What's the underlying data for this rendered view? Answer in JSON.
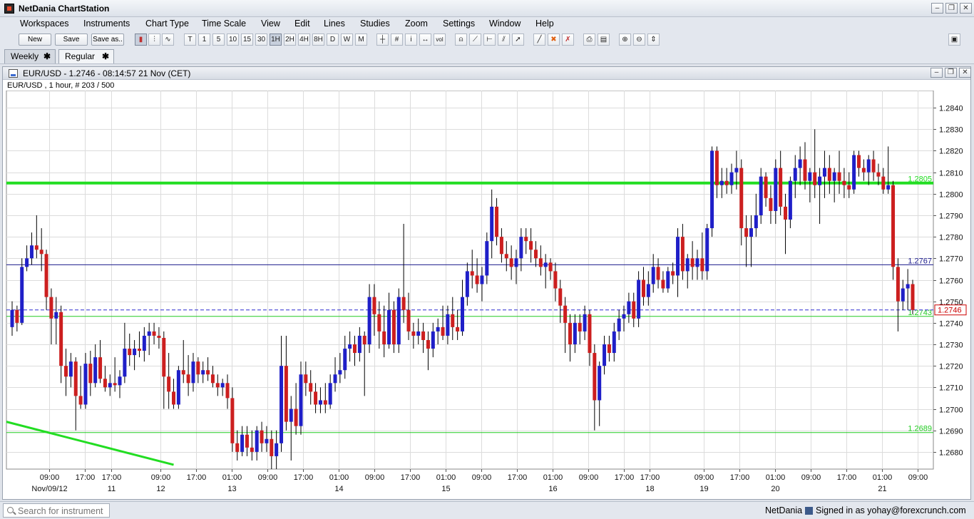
{
  "app": {
    "title": "NetDania ChartStation"
  },
  "menu": [
    "Workspaces",
    "Instruments",
    "Chart Type",
    "Time Scale",
    "View",
    "Edit",
    "Lines",
    "Studies",
    "Zoom",
    "Settings",
    "Window",
    "Help"
  ],
  "toolbar": {
    "new_label": "New",
    "save_label": "Save",
    "saveas_label": "Save as..",
    "interval_buttons": [
      "T",
      "1",
      "5",
      "10",
      "15",
      "30",
      "1H",
      "2H",
      "4H",
      "8H",
      "D",
      "W",
      "M"
    ],
    "active_interval": "1H",
    "vol_label": "vol"
  },
  "tabs": [
    {
      "label": "Weekly",
      "close": "✱"
    },
    {
      "label": "Regular",
      "close": "✱"
    }
  ],
  "chart": {
    "window_title": "EUR/USD - 1.2746 - 08:14:57  21 Nov (CET)",
    "subtitle": "EUR/USD , 1 hour, # 203 / 500"
  },
  "chart_data": {
    "type": "candlestick",
    "instrument": "EUR/USD",
    "interval": "1 hour",
    "last_price": 1.2746,
    "ylim": [
      1.2672,
      1.2848
    ],
    "y_ticks": [
      "1.2680",
      "1.2690",
      "1.2700",
      "1.2710",
      "1.2720",
      "1.2730",
      "1.2740",
      "1.2750",
      "1.2760",
      "1.2770",
      "1.2780",
      "1.2790",
      "1.2800",
      "1.2810",
      "1.2820",
      "1.2830",
      "1.2840"
    ],
    "x_ticks": [
      {
        "time": "09:00",
        "date": "Nov/09/12"
      },
      {
        "time": "17:00",
        "date": ""
      },
      {
        "time": "17:00",
        "date": "11"
      },
      {
        "time": "09:00",
        "date": "12"
      },
      {
        "time": "17:00",
        "date": ""
      },
      {
        "time": "01:00",
        "date": "13"
      },
      {
        "time": "09:00",
        "date": ""
      },
      {
        "time": "17:00",
        "date": ""
      },
      {
        "time": "01:00",
        "date": "14"
      },
      {
        "time": "09:00",
        "date": ""
      },
      {
        "time": "17:00",
        "date": ""
      },
      {
        "time": "01:00",
        "date": "15"
      },
      {
        "time": "09:00",
        "date": ""
      },
      {
        "time": "17:00",
        "date": ""
      },
      {
        "time": "01:00",
        "date": "16"
      },
      {
        "time": "09:00",
        "date": ""
      },
      {
        "time": "17:00",
        "date": ""
      },
      {
        "time": "17:00",
        "date": "18"
      },
      {
        "time": "09:00",
        "date": "19"
      },
      {
        "time": "17:00",
        "date": ""
      },
      {
        "time": "01:00",
        "date": "20"
      },
      {
        "time": "09:00",
        "date": ""
      },
      {
        "time": "17:00",
        "date": ""
      },
      {
        "time": "01:00",
        "date": "21"
      },
      {
        "time": "09:00",
        "date": ""
      }
    ],
    "horizontal_lines": [
      {
        "label": "1.2805",
        "value": 1.2805,
        "color": "#22dd22",
        "style": "thick"
      },
      {
        "label": "1.2767",
        "value": 1.2767,
        "color": "#1a1a8c",
        "style": "thin"
      },
      {
        "label": "1.2743",
        "value": 1.2743,
        "color": "#22cc22",
        "style": "thin"
      },
      {
        "label": "1.2689",
        "value": 1.2689,
        "color": "#22cc22",
        "style": "thin"
      }
    ],
    "price_marker": {
      "label": "1.2746",
      "value": 1.2746,
      "color": "#cc0000"
    },
    "colors": {
      "up": "#1f1fc8",
      "down": "#cc1f1f",
      "wick": "#000000"
    },
    "candles": [
      [
        1.2738,
        1.275,
        1.2734,
        1.2746
      ],
      [
        1.2746,
        1.2748,
        1.2736,
        1.274
      ],
      [
        1.274,
        1.277,
        1.2739,
        1.2766
      ],
      [
        1.2766,
        1.2776,
        1.2764,
        1.277
      ],
      [
        1.277,
        1.2782,
        1.2767,
        1.2776
      ],
      [
        1.2776,
        1.279,
        1.277,
        1.2774
      ],
      [
        1.2774,
        1.2784,
        1.2764,
        1.2772
      ],
      [
        1.2772,
        1.2774,
        1.2746,
        1.2752
      ],
      [
        1.2752,
        1.2756,
        1.273,
        1.2742
      ],
      [
        1.2742,
        1.2752,
        1.273,
        1.2745
      ],
      [
        1.2745,
        1.2748,
        1.2712,
        1.272
      ],
      [
        1.272,
        1.2728,
        1.2706,
        1.2715
      ],
      [
        1.2715,
        1.2726,
        1.271,
        1.2722
      ],
      [
        1.2722,
        1.2724,
        1.269,
        1.2706
      ],
      [
        1.2706,
        1.272,
        1.27,
        1.2702
      ],
      [
        1.2702,
        1.2726,
        1.27,
        1.2721
      ],
      [
        1.2721,
        1.2727,
        1.2706,
        1.2712
      ],
      [
        1.2712,
        1.273,
        1.271,
        1.2724
      ],
      [
        1.2724,
        1.2732,
        1.2712,
        1.2714
      ],
      [
        1.2714,
        1.272,
        1.2708,
        1.271
      ],
      [
        1.271,
        1.2716,
        1.2706,
        1.2712
      ],
      [
        1.2712,
        1.2724,
        1.2708,
        1.2711
      ],
      [
        1.2711,
        1.2718,
        1.2705,
        1.2715
      ],
      [
        1.2715,
        1.274,
        1.2712,
        1.2728
      ],
      [
        1.2728,
        1.2735,
        1.272,
        1.2725
      ],
      [
        1.2725,
        1.2732,
        1.2718,
        1.2728
      ],
      [
        1.2728,
        1.2736,
        1.2724,
        1.2727
      ],
      [
        1.2727,
        1.2738,
        1.2722,
        1.2734
      ],
      [
        1.2734,
        1.274,
        1.2725,
        1.2736
      ],
      [
        1.2736,
        1.274,
        1.273,
        1.2734
      ],
      [
        1.2734,
        1.2738,
        1.2728,
        1.2733
      ],
      [
        1.2733,
        1.2736,
        1.27,
        1.2715
      ],
      [
        1.2715,
        1.2726,
        1.27,
        1.2708
      ],
      [
        1.2708,
        1.2714,
        1.27,
        1.2702
      ],
      [
        1.2702,
        1.272,
        1.27,
        1.2718
      ],
      [
        1.2718,
        1.2732,
        1.2712,
        1.2716
      ],
      [
        1.2716,
        1.2725,
        1.2706,
        1.2712
      ],
      [
        1.2712,
        1.2726,
        1.2708,
        1.2722
      ],
      [
        1.2722,
        1.2724,
        1.2712,
        1.2716
      ],
      [
        1.2716,
        1.2722,
        1.2712,
        1.2718
      ],
      [
        1.2718,
        1.2724,
        1.2713,
        1.2716
      ],
      [
        1.2716,
        1.272,
        1.271,
        1.2712
      ],
      [
        1.2712,
        1.2716,
        1.2706,
        1.271
      ],
      [
        1.271,
        1.2714,
        1.2706,
        1.2712
      ],
      [
        1.2712,
        1.2716,
        1.27,
        1.2705
      ],
      [
        1.2705,
        1.271,
        1.268,
        1.2684
      ],
      [
        1.2684,
        1.269,
        1.2676,
        1.268
      ],
      [
        1.268,
        1.2692,
        1.2678,
        1.2688
      ],
      [
        1.2688,
        1.2692,
        1.2678,
        1.2682
      ],
      [
        1.2682,
        1.269,
        1.2676,
        1.268
      ],
      [
        1.268,
        1.2692,
        1.2676,
        1.269
      ],
      [
        1.269,
        1.2694,
        1.268,
        1.2684
      ],
      [
        1.2684,
        1.2692,
        1.268,
        1.2686
      ],
      [
        1.2686,
        1.269,
        1.2672,
        1.2678
      ],
      [
        1.2678,
        1.269,
        1.2672,
        1.2684
      ],
      [
        1.2684,
        1.2734,
        1.268,
        1.272
      ],
      [
        1.272,
        1.2734,
        1.269,
        1.2694
      ],
      [
        1.2694,
        1.2706,
        1.2676,
        1.27
      ],
      [
        1.27,
        1.2712,
        1.2688,
        1.2692
      ],
      [
        1.2692,
        1.2722,
        1.2688,
        1.2716
      ],
      [
        1.2716,
        1.2722,
        1.2706,
        1.2712
      ],
      [
        1.2712,
        1.2718,
        1.2702,
        1.2708
      ],
      [
        1.2708,
        1.2712,
        1.2698,
        1.2702
      ],
      [
        1.2702,
        1.271,
        1.2698,
        1.2704
      ],
      [
        1.2704,
        1.2712,
        1.2698,
        1.2702
      ],
      [
        1.2702,
        1.2716,
        1.27,
        1.2712
      ],
      [
        1.2712,
        1.2724,
        1.2708,
        1.2716
      ],
      [
        1.2716,
        1.2726,
        1.2712,
        1.2718
      ],
      [
        1.2718,
        1.2734,
        1.2714,
        1.2728
      ],
      [
        1.2728,
        1.2736,
        1.2722,
        1.273
      ],
      [
        1.273,
        1.2734,
        1.272,
        1.2726
      ],
      [
        1.2726,
        1.2738,
        1.2722,
        1.2734
      ],
      [
        1.2734,
        1.2736,
        1.2706,
        1.273
      ],
      [
        1.273,
        1.2758,
        1.2726,
        1.2752
      ],
      [
        1.2752,
        1.2758,
        1.2734,
        1.2744
      ],
      [
        1.2744,
        1.275,
        1.2728,
        1.2736
      ],
      [
        1.2736,
        1.2748,
        1.2724,
        1.273
      ],
      [
        1.273,
        1.2754,
        1.2728,
        1.2746
      ],
      [
        1.2746,
        1.275,
        1.2726,
        1.273
      ],
      [
        1.273,
        1.2756,
        1.2726,
        1.2752
      ],
      [
        1.2752,
        1.2786,
        1.274,
        1.2746
      ],
      [
        1.2746,
        1.2754,
        1.2732,
        1.2736
      ],
      [
        1.2736,
        1.274,
        1.2728,
        1.2734
      ],
      [
        1.2734,
        1.2742,
        1.273,
        1.2736
      ],
      [
        1.2736,
        1.274,
        1.2726,
        1.2732
      ],
      [
        1.2732,
        1.2736,
        1.2718,
        1.2728
      ],
      [
        1.2728,
        1.274,
        1.2724,
        1.2736
      ],
      [
        1.2736,
        1.2742,
        1.273,
        1.2738
      ],
      [
        1.2738,
        1.2748,
        1.2732,
        1.2734
      ],
      [
        1.2734,
        1.2748,
        1.273,
        1.2744
      ],
      [
        1.2744,
        1.2752,
        1.2732,
        1.2738
      ],
      [
        1.2738,
        1.2746,
        1.2732,
        1.2736
      ],
      [
        1.2736,
        1.276,
        1.2734,
        1.2752
      ],
      [
        1.2752,
        1.2768,
        1.2748,
        1.2764
      ],
      [
        1.2764,
        1.2774,
        1.2756,
        1.2762
      ],
      [
        1.2762,
        1.277,
        1.2754,
        1.2758
      ],
      [
        1.2758,
        1.2766,
        1.275,
        1.2762
      ],
      [
        1.2762,
        1.2782,
        1.2758,
        1.2778
      ],
      [
        1.2778,
        1.2802,
        1.277,
        1.2794
      ],
      [
        1.2794,
        1.2798,
        1.2776,
        1.278
      ],
      [
        1.278,
        1.2784,
        1.2768,
        1.2772
      ],
      [
        1.2772,
        1.2778,
        1.2764,
        1.277
      ],
      [
        1.277,
        1.2776,
        1.276,
        1.2766
      ],
      [
        1.2766,
        1.2774,
        1.2758,
        1.277
      ],
      [
        1.277,
        1.2784,
        1.2764,
        1.278
      ],
      [
        1.278,
        1.2784,
        1.2772,
        1.2778
      ],
      [
        1.2778,
        1.2784,
        1.2768,
        1.2774
      ],
      [
        1.2774,
        1.2778,
        1.2766,
        1.277
      ],
      [
        1.277,
        1.2776,
        1.2762,
        1.2766
      ],
      [
        1.2766,
        1.2772,
        1.2756,
        1.2768
      ],
      [
        1.2768,
        1.277,
        1.276,
        1.2764
      ],
      [
        1.2764,
        1.2768,
        1.275,
        1.2756
      ],
      [
        1.2756,
        1.276,
        1.274,
        1.2748
      ],
      [
        1.2748,
        1.2752,
        1.2726,
        1.274
      ],
      [
        1.274,
        1.2744,
        1.2722,
        1.273
      ],
      [
        1.273,
        1.2744,
        1.2726,
        1.274
      ],
      [
        1.274,
        1.2744,
        1.273,
        1.2736
      ],
      [
        1.2736,
        1.2748,
        1.2732,
        1.2744
      ],
      [
        1.2744,
        1.2746,
        1.272,
        1.2726
      ],
      [
        1.2726,
        1.273,
        1.269,
        1.2704
      ],
      [
        1.2704,
        1.2722,
        1.2692,
        1.272
      ],
      [
        1.272,
        1.2734,
        1.2716,
        1.273
      ],
      [
        1.273,
        1.2734,
        1.2722,
        1.2726
      ],
      [
        1.2726,
        1.274,
        1.2722,
        1.2736
      ],
      [
        1.2736,
        1.2746,
        1.2732,
        1.2742
      ],
      [
        1.2742,
        1.2748,
        1.2736,
        1.2744
      ],
      [
        1.2744,
        1.2754,
        1.274,
        1.275
      ],
      [
        1.275,
        1.2754,
        1.2738,
        1.2742
      ],
      [
        1.2742,
        1.2764,
        1.2738,
        1.276
      ],
      [
        1.276,
        1.2766,
        1.2748,
        1.2752
      ],
      [
        1.2752,
        1.2764,
        1.2748,
        1.2758
      ],
      [
        1.2758,
        1.2772,
        1.2754,
        1.2766
      ],
      [
        1.2766,
        1.277,
        1.2756,
        1.276
      ],
      [
        1.276,
        1.2764,
        1.2754,
        1.2756
      ],
      [
        1.2756,
        1.2766,
        1.2754,
        1.2764
      ],
      [
        1.2764,
        1.2768,
        1.2758,
        1.2762
      ],
      [
        1.2762,
        1.2784,
        1.2752,
        1.278
      ],
      [
        1.278,
        1.2786,
        1.276,
        1.2764
      ],
      [
        1.2764,
        1.2772,
        1.2756,
        1.277
      ],
      [
        1.277,
        1.2778,
        1.276,
        1.2766
      ],
      [
        1.2766,
        1.2774,
        1.276,
        1.277
      ],
      [
        1.277,
        1.2782,
        1.276,
        1.2764
      ],
      [
        1.2764,
        1.2786,
        1.276,
        1.2784
      ],
      [
        1.2784,
        1.2822,
        1.278,
        1.282
      ],
      [
        1.282,
        1.2822,
        1.2798,
        1.2804
      ],
      [
        1.2804,
        1.2812,
        1.2798,
        1.2806
      ],
      [
        1.2806,
        1.2812,
        1.28,
        1.2804
      ],
      [
        1.2804,
        1.2814,
        1.28,
        1.281
      ],
      [
        1.281,
        1.282,
        1.2802,
        1.2812
      ],
      [
        1.2812,
        1.2816,
        1.2776,
        1.2784
      ],
      [
        1.2784,
        1.279,
        1.2766,
        1.278
      ],
      [
        1.278,
        1.279,
        1.2766,
        1.2784
      ],
      [
        1.2784,
        1.28,
        1.278,
        1.279
      ],
      [
        1.279,
        1.2812,
        1.2786,
        1.2808
      ],
      [
        1.2808,
        1.281,
        1.2794,
        1.2798
      ],
      [
        1.2798,
        1.2804,
        1.2786,
        1.2792
      ],
      [
        1.2792,
        1.2816,
        1.2786,
        1.2812
      ],
      [
        1.2812,
        1.282,
        1.279,
        1.2794
      ],
      [
        1.2794,
        1.28,
        1.2772,
        1.2788
      ],
      [
        1.2788,
        1.2808,
        1.2784,
        1.2806
      ],
      [
        1.2806,
        1.2818,
        1.2798,
        1.2812
      ],
      [
        1.2812,
        1.2822,
        1.2804,
        1.2816
      ],
      [
        1.2816,
        1.2824,
        1.2802,
        1.2806
      ],
      [
        1.2806,
        1.2812,
        1.2796,
        1.281
      ],
      [
        1.281,
        1.283,
        1.2798,
        1.2804
      ],
      [
        1.2804,
        1.2812,
        1.2786,
        1.2808
      ],
      [
        1.2808,
        1.282,
        1.2798,
        1.2812
      ],
      [
        1.2812,
        1.2818,
        1.28,
        1.2806
      ],
      [
        1.2806,
        1.2812,
        1.2796,
        1.281
      ],
      [
        1.281,
        1.282,
        1.28,
        1.2806
      ],
      [
        1.2806,
        1.2812,
        1.2798,
        1.2804
      ],
      [
        1.2804,
        1.281,
        1.2798,
        1.2802
      ],
      [
        1.2802,
        1.282,
        1.28,
        1.2818
      ],
      [
        1.2818,
        1.282,
        1.2808,
        1.2812
      ],
      [
        1.2812,
        1.2816,
        1.2806,
        1.281
      ],
      [
        1.281,
        1.2818,
        1.2804,
        1.2816
      ],
      [
        1.2816,
        1.282,
        1.2806,
        1.281
      ],
      [
        1.281,
        1.2814,
        1.2804,
        1.2808
      ],
      [
        1.2808,
        1.2812,
        1.28,
        1.2802
      ],
      [
        1.2802,
        1.2822,
        1.28,
        1.2804
      ],
      [
        1.2804,
        1.2806,
        1.276,
        1.2766
      ],
      [
        1.2766,
        1.277,
        1.2736,
        1.275
      ],
      [
        1.275,
        1.276,
        1.2746,
        1.2756
      ],
      [
        1.2756,
        1.2765,
        1.2746,
        1.2758
      ],
      [
        1.2758,
        1.276,
        1.2744,
        1.2746
      ]
    ],
    "trendline": {
      "from": [
        0,
        1.2694
      ],
      "to": [
        33,
        1.2674
      ],
      "color": "#22dd22"
    }
  },
  "statusbar": {
    "search_placeholder": "Search for instrument",
    "brand": "NetDania",
    "signed_in": "Signed in as yohay@forexcrunch.com"
  }
}
